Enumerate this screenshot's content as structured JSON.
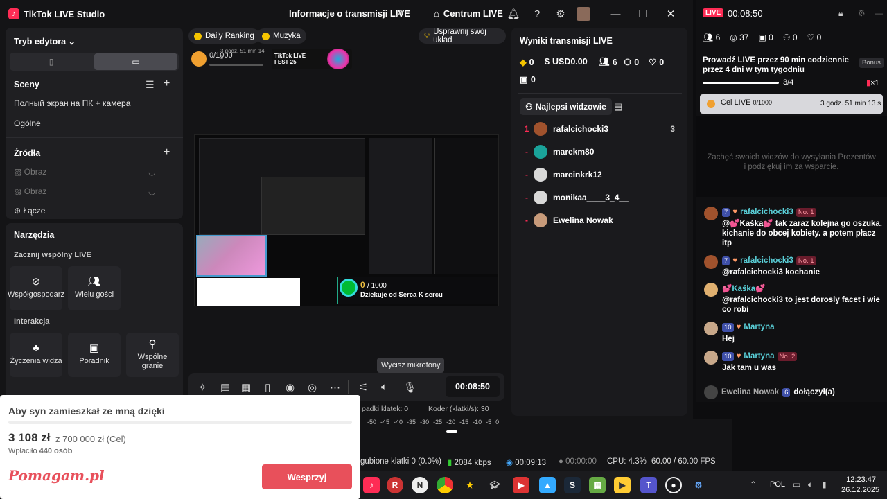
{
  "app": {
    "name": "TikTok LIVE Studio",
    "center_title": "Informacje o transmisji LIVE",
    "hub_label": "Centrum LIVE"
  },
  "left": {
    "editor_mode": "Tryb edytora",
    "scenes_title": "Sceny",
    "scenes": [
      "Полный экран на ПК + камера",
      "Ogólne"
    ],
    "sources_title": "Źródła",
    "sources": [
      "Obraz",
      "Obraz",
      "Łącze"
    ],
    "tools_title": "Narzędzia",
    "shared_live": "Zacznij wspólny LIVE",
    "cohost": "Współgospodarz",
    "multi_guest": "Wielu gości",
    "interaction": "Interakcja",
    "wishes": "Życzenia widza",
    "guide": "Poradnik",
    "support": "Wspólne granie"
  },
  "preview": {
    "chip_ranking": "Daily Ranking",
    "chip_music": "Muzyka",
    "chip_improve": "Usprawnij swój układ",
    "goal_progress": "0/1000",
    "goal_time": "3 godz. 51 min 14 s",
    "fest_label": "TikTok LIVE FEST 25",
    "gift_value": "0",
    "gift_total": "/ 1000",
    "gift_text": "Dziekuje od Serca K sercu"
  },
  "bottom": {
    "timer": "00:08:50",
    "tooltip": "Wycisz mikrofony"
  },
  "results": {
    "title": "Wyniki transmisji LIVE",
    "diamonds": "0",
    "usd": "USD0.00",
    "viewers": "6",
    "new_followers": "0",
    "likes": "0",
    "gifts": "0",
    "top_viewers_btn": "Najlepsi widzowie",
    "top_viewers": [
      {
        "rank": "1",
        "name": "rafalcichocki3",
        "score": "3",
        "color": "#a0522d"
      },
      {
        "rank": "-",
        "name": "marekm80",
        "score": "",
        "color": "#1aa39a"
      },
      {
        "rank": "-",
        "name": "marcinkrk12",
        "score": "",
        "color": "#d8d8d8"
      },
      {
        "rank": "-",
        "name": "monikaa____3_4__",
        "score": "",
        "color": "#d8d8d8"
      },
      {
        "rank": "-",
        "name": "Ewelina Nowak",
        "score": "",
        "color": "#c79a7a"
      }
    ]
  },
  "chat": {
    "live_badge": "LIVE",
    "live_time": "00:08:50",
    "stat_viewers": "6",
    "stat_total": "37",
    "stat_gifts": "0",
    "stat_follow": "0",
    "stat_likes": "0",
    "challenge": "Prowadź LIVE przez 90 min codziennie przez 4 dni w tym tygodniu",
    "bonus": "Bonus",
    "challenge_progress": "3/4",
    "challenge_mult": "×1",
    "goal_label": "Cel LIVE",
    "goal_value": "0/1000",
    "goal_time": "3 godz. 51 min 13 s",
    "empty_text": "Zachęć swoich widzów do wysyłania Prezentów i podziękuj im za wsparcie.",
    "messages": [
      {
        "level": "7",
        "user": "rafalcichocki3",
        "badge": "No. 1",
        "text": "@💕Kaśka💕 tak zaraz kolejna go oszuka. kichanie do obcej kobiety. a potem płacz itp",
        "color": "#a0522d"
      },
      {
        "level": "7",
        "user": "rafalcichocki3",
        "badge": "No. 1",
        "text": "@rafalcichocki3 kochanie",
        "color": "#a0522d"
      },
      {
        "level": "",
        "user": "💕Kaśka💕",
        "badge": "",
        "text": "@rafalcichocki3 to jest dorosly facet i wie co robi",
        "color": "#e0b070"
      },
      {
        "level": "10",
        "user": "Martyna",
        "badge": "",
        "text": "Hej",
        "color": "#c8a88a"
      },
      {
        "level": "10",
        "user": "Martyna",
        "badge": "No. 2",
        "text": "Jak tam u was",
        "color": "#c8a88a"
      }
    ],
    "join_user": "Ewelina Nowak",
    "join_level": "6",
    "join_text": "dołączył(a)"
  },
  "donation": {
    "title": "Aby syn zamieszkał ze mną dzięki",
    "raised": "3 108 zł",
    "goal": "z 700 000 zł (Cel)",
    "donors_label": "Wpłaciło",
    "donors": "440 osób",
    "brand": "Pomagam.pl",
    "button": "Wesprzyj"
  },
  "status": {
    "dropped_label": "padki klatek:",
    "dropped": "0",
    "encoder_label": "Koder (klatki/s):",
    "encoder": "30",
    "lost": "gubione klatki 0 (0.0%)",
    "bitrate": "2084 kbps",
    "elapsed": "00:09:13",
    "rec": "00:00:00",
    "cpu": "CPU: 4.3%",
    "fps": "60.00 / 60.00 FPS",
    "scale": [
      "-50",
      "-45",
      "-40",
      "-35",
      "-30",
      "-25",
      "-20",
      "-15",
      "-10",
      "-5",
      "0"
    ]
  },
  "taskbar": {
    "lang": "POL",
    "time": "12:23:47",
    "date": "26.12.2025"
  }
}
